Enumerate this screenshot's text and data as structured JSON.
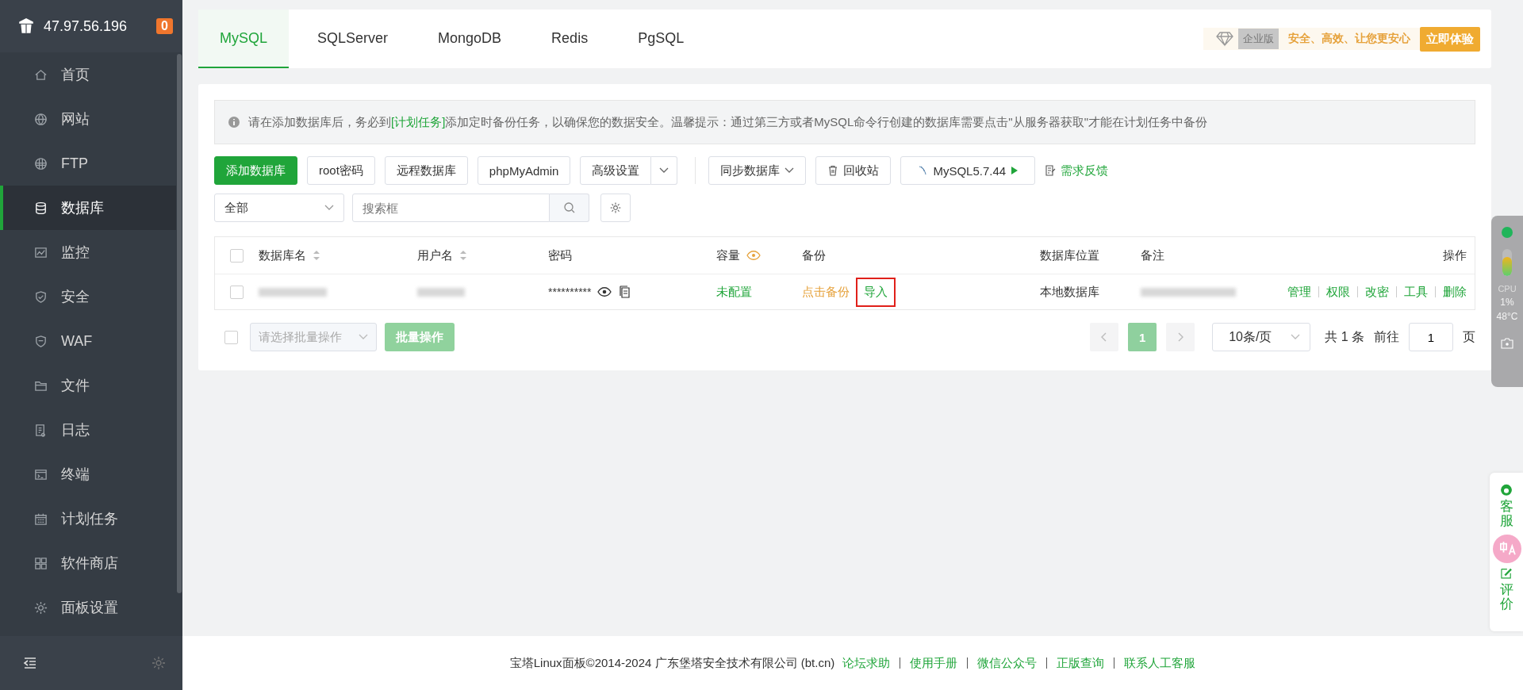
{
  "sidebar": {
    "host": "47.97.56.196",
    "badge": "0",
    "items": [
      {
        "label": "首页",
        "selected": false
      },
      {
        "label": "网站",
        "selected": false
      },
      {
        "label": "FTP",
        "selected": false
      },
      {
        "label": "数据库",
        "selected": true
      },
      {
        "label": "监控",
        "selected": false
      },
      {
        "label": "安全",
        "selected": false
      },
      {
        "label": "WAF",
        "selected": false
      },
      {
        "label": "文件",
        "selected": false
      },
      {
        "label": "日志",
        "selected": false
      },
      {
        "label": "终端",
        "selected": false
      },
      {
        "label": "计划任务",
        "selected": false
      },
      {
        "label": "软件商店",
        "selected": false
      },
      {
        "label": "面板设置",
        "selected": false
      }
    ]
  },
  "tabs": [
    {
      "label": "MySQL",
      "selected": true
    },
    {
      "label": "SQLServer",
      "selected": false
    },
    {
      "label": "MongoDB",
      "selected": false
    },
    {
      "label": "Redis",
      "selected": false
    },
    {
      "label": "PgSQL",
      "selected": false
    }
  ],
  "promo": {
    "edition": "企业版",
    "slogan": "安全、高效、让您更安心",
    "button": "立即体验"
  },
  "notice": {
    "before": "请在添加数据库后，务必到",
    "link": "[计划任务]",
    "after": "添加定时备份任务，以确保您的数据安全。温馨提示：通过第三方或者MySQL命令行创建的数据库需要点击\"从服务器获取\"才能在计划任务中备份"
  },
  "toolbar": [
    {
      "label": "添加数据库",
      "kind": "primary"
    },
    {
      "label": "root密码",
      "kind": "plain"
    },
    {
      "label": "远程数据库",
      "kind": "plain"
    },
    {
      "label": "phpMyAdmin",
      "kind": "plain"
    },
    {
      "label": "高级设置",
      "kind": "split"
    },
    {
      "label": "同步数据库",
      "kind": "dropdown"
    },
    {
      "label": "回收站",
      "kind": "trash"
    },
    {
      "label": "MySQL5.7.44",
      "kind": "version"
    },
    {
      "label": "需求反馈",
      "kind": "feedback"
    }
  ],
  "filter": {
    "select": "全部",
    "placeholder": "搜索框"
  },
  "table": {
    "select_all_checked": false,
    "columns": [
      {
        "label": "数据库名",
        "sortable": true
      },
      {
        "label": "用户名",
        "sortable": true
      },
      {
        "label": "密码",
        "sortable": false
      },
      {
        "label": "容量",
        "sortable": false
      },
      {
        "label": "备份",
        "sortable": false
      },
      {
        "label": "数据库位置",
        "sortable": false
      },
      {
        "label": "备注",
        "sortable": false
      },
      {
        "label": "操作",
        "sortable": false
      }
    ],
    "rows": [
      {
        "checked": false,
        "password": "**********",
        "capacity": "未配置",
        "backup": "点击备份",
        "import": "导入",
        "import_highlighted": true,
        "location": "本地数据库",
        "actions": [
          "管理",
          "权限",
          "改密",
          "工具",
          "删除"
        ]
      }
    ]
  },
  "bulk": {
    "select_all_checked": false,
    "placeholder": "请选择批量操作",
    "button": "批量操作",
    "disabled": true
  },
  "pagination": {
    "page": "1",
    "per_page": "10条/页",
    "total": "共 1 条",
    "goto": "前往",
    "goto_value": "1",
    "unit": "页"
  },
  "monitor": {
    "label": "CPU",
    "cpu": "1%",
    "temp": "48°C",
    "level": 0.7
  },
  "service": {
    "chat": "客服",
    "review": "评价"
  },
  "footer": {
    "copyright": "宝塔Linux面板©2014-2024 广东堡塔安全技术有限公司 (bt.cn)",
    "links": [
      "论坛求助",
      "使用手册",
      "微信公众号",
      "正版查询",
      "联系人工客服"
    ]
  }
}
